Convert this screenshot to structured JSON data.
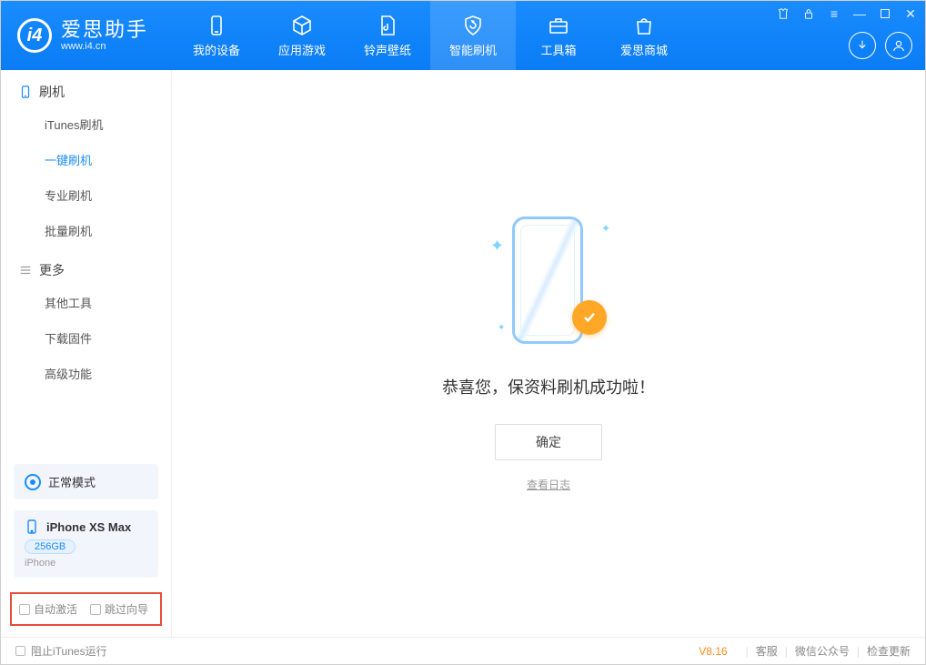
{
  "app": {
    "title": "爱思助手",
    "subtitle": "www.i4.cn"
  },
  "topTabs": {
    "device": "我的设备",
    "apps": "应用游戏",
    "ring": "铃声壁纸",
    "flash": "智能刷机",
    "toolbox": "工具箱",
    "store": "爱思商城"
  },
  "sidebar": {
    "section_flash": "刷机",
    "items_flash": {
      "itunes": "iTunes刷机",
      "oneclick": "一键刷机",
      "pro": "专业刷机",
      "batch": "批量刷机"
    },
    "section_more": "更多",
    "items_more": {
      "other": "其他工具",
      "firmware": "下载固件",
      "advanced": "高级功能"
    }
  },
  "mode": {
    "label": "正常模式"
  },
  "device": {
    "name": "iPhone XS Max",
    "capacity": "256GB",
    "type": "iPhone"
  },
  "checks": {
    "auto_activate": "自动激活",
    "skip_guide": "跳过向导"
  },
  "main": {
    "success": "恭喜您，保资料刷机成功啦！",
    "ok": "确定",
    "view_log": "查看日志"
  },
  "footer": {
    "block_itunes": "阻止iTunes运行",
    "version": "V8.16",
    "support": "客服",
    "wechat": "微信公众号",
    "update": "检查更新"
  }
}
